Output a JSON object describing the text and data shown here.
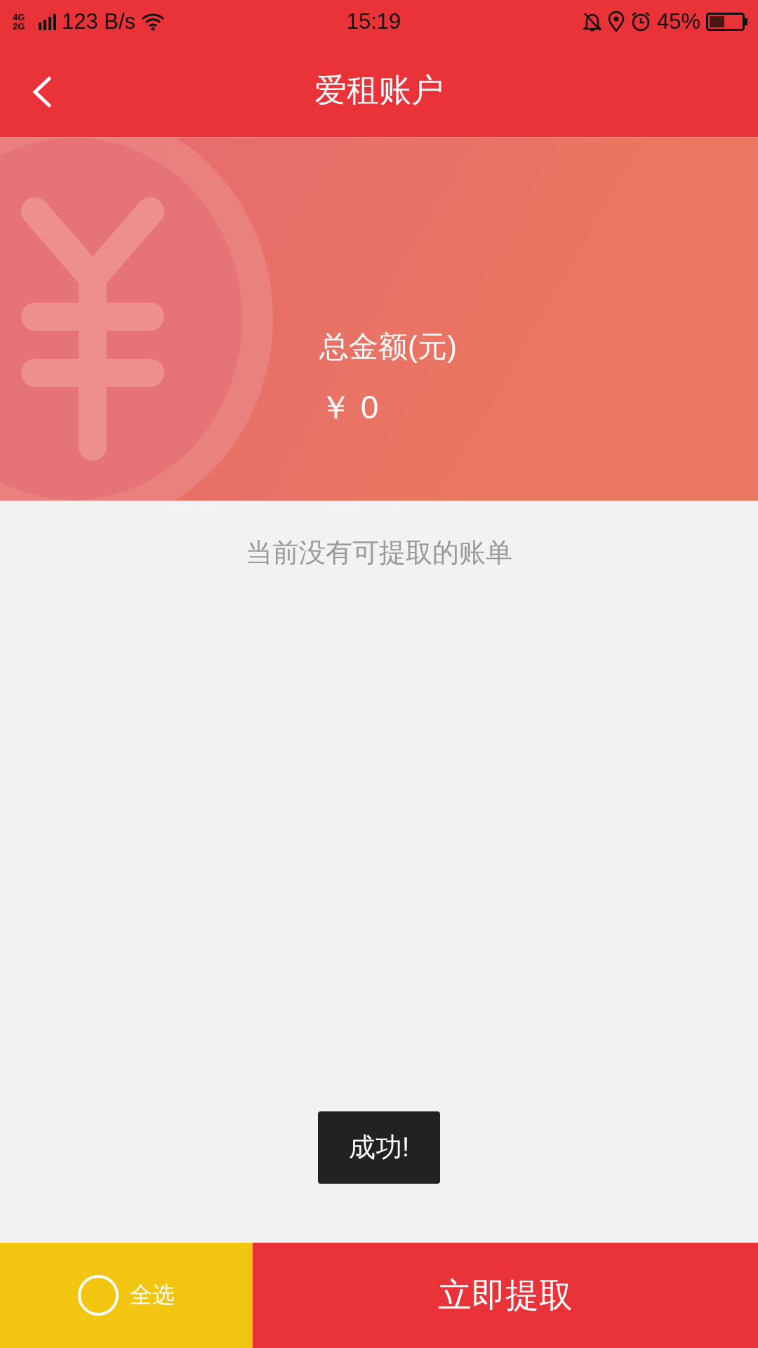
{
  "status_bar": {
    "network": "4G 2G",
    "speed": "123 B/s",
    "time": "15:19",
    "battery": "45%"
  },
  "header": {
    "title": "爱租账户"
  },
  "banner": {
    "label": "总金额(元)",
    "amount": "￥ 0"
  },
  "empty_message": "当前没有可提取的账单",
  "toast": "成功!",
  "bottom_bar": {
    "select_all": {
      "label": "全选",
      "checked": false
    },
    "withdraw_button": "立即提取"
  }
}
